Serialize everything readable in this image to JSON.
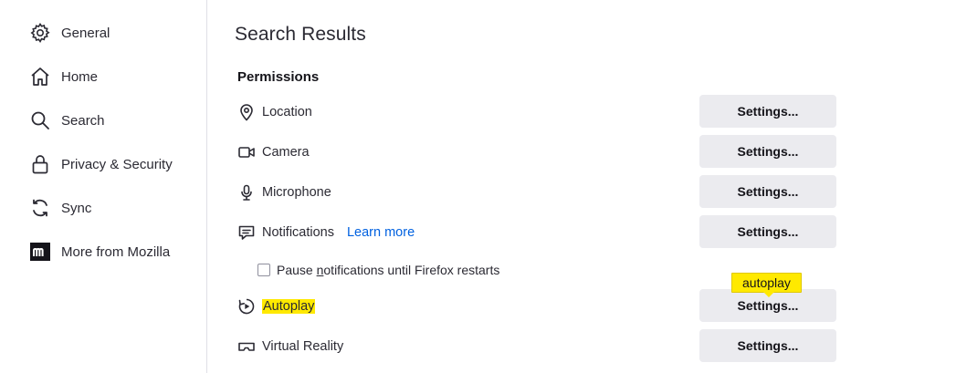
{
  "sidebar": {
    "items": [
      {
        "label": "General",
        "icon": "gear-icon"
      },
      {
        "label": "Home",
        "icon": "home-icon"
      },
      {
        "label": "Search",
        "icon": "search-icon"
      },
      {
        "label": "Privacy & Security",
        "icon": "lock-icon"
      },
      {
        "label": "Sync",
        "icon": "sync-icon"
      },
      {
        "label": "More from Mozilla",
        "icon": "mozilla-icon"
      }
    ]
  },
  "main": {
    "title": "Search Results",
    "section_title": "Permissions",
    "permissions": [
      {
        "label": "Location",
        "icon": "location-icon",
        "button": "Settings..."
      },
      {
        "label": "Camera",
        "icon": "camera-icon",
        "button": "Settings..."
      },
      {
        "label": "Microphone",
        "icon": "microphone-icon",
        "button": "Settings..."
      },
      {
        "label": "Notifications",
        "icon": "notifications-icon",
        "button": "Settings...",
        "link": "Learn more"
      },
      {
        "label": "Autoplay",
        "icon": "autoplay-icon",
        "button": "Settings..."
      },
      {
        "label": "Virtual Reality",
        "icon": "vr-icon",
        "button": "Settings..."
      }
    ],
    "pause_notifications": {
      "before": "Pause ",
      "underlined": "n",
      "after": "otifications until Firefox restarts",
      "checked": false
    },
    "tooltip": "autoplay"
  },
  "colors": {
    "highlight": "#ffe900",
    "link": "#0061e0",
    "button_bg": "#ebebef"
  }
}
